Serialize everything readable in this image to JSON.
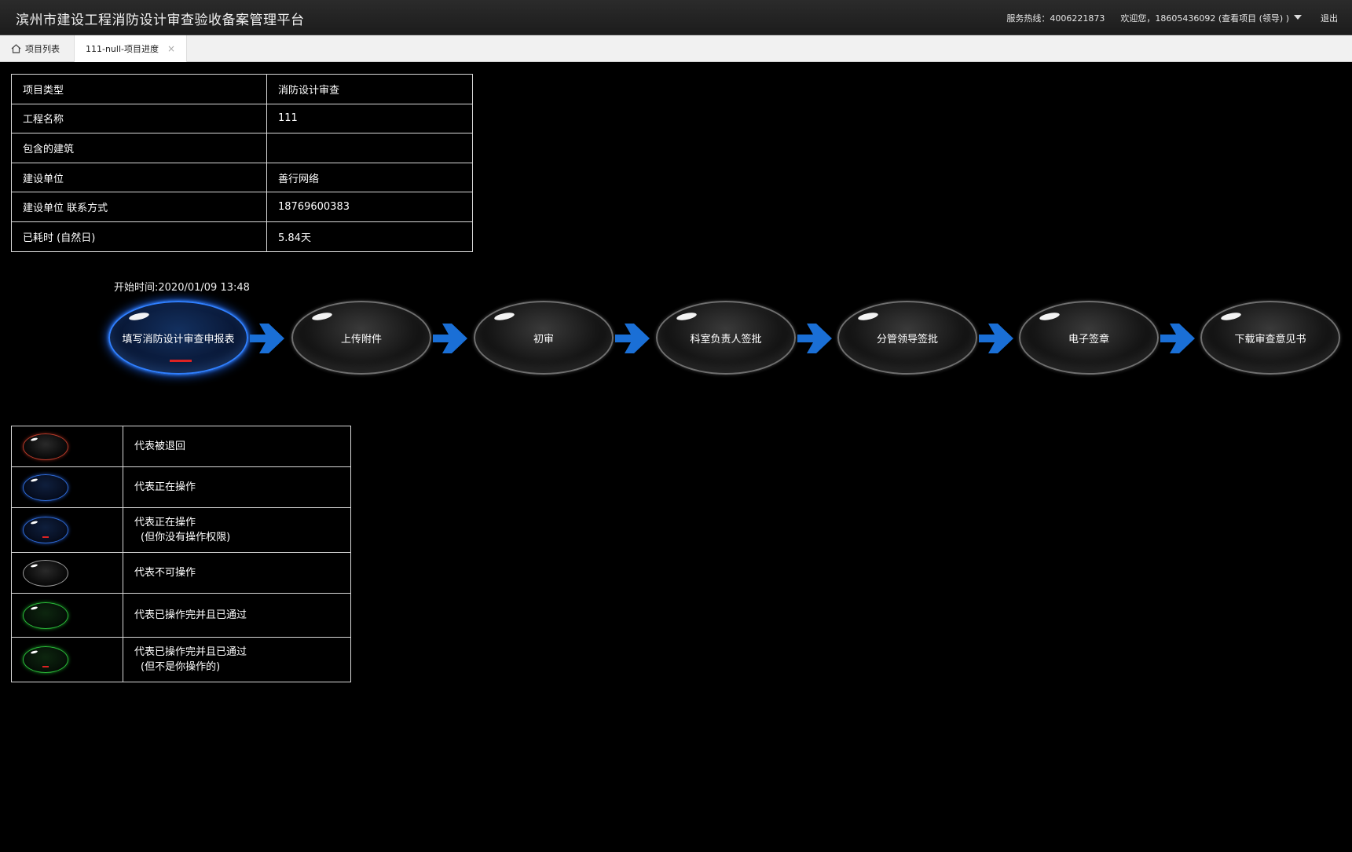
{
  "header": {
    "title": "滨州市建设工程消防设计审查验收备案管理平台",
    "hotline": "服务热线：4006221873",
    "welcome": "欢迎您，18605436092 (查看项目 (领导) )",
    "logout": "退出"
  },
  "tabs": {
    "home_label": "项目列表",
    "active_label": "111-null-项目进度",
    "close_glyph": "×"
  },
  "info": {
    "rows": [
      {
        "key": "项目类型",
        "value": "消防设计审查"
      },
      {
        "key": "工程名称",
        "value": "111"
      },
      {
        "key": "包含的建筑",
        "value": ""
      },
      {
        "key": "建设单位",
        "value": "善行网络"
      },
      {
        "key": "建设单位 联系方式",
        "value": "18769600383"
      },
      {
        "key": "已耗时 (自然日)",
        "value": "5.84天"
      }
    ]
  },
  "flow": {
    "start_time": "开始时间:2020/01/09 13:48",
    "steps": [
      {
        "label": "填写消防设计审查申报表",
        "state": "active-no-permission"
      },
      {
        "label": "上传附件",
        "state": "disabled"
      },
      {
        "label": "初审",
        "state": "disabled"
      },
      {
        "label": "科室负责人签批",
        "state": "disabled"
      },
      {
        "label": "分管领导签批",
        "state": "disabled"
      },
      {
        "label": "电子签章",
        "state": "disabled"
      },
      {
        "label": "下载审查意见书",
        "state": "disabled"
      }
    ],
    "arrow_color": "#1a6fd6"
  },
  "legend": {
    "rows": [
      {
        "label": "代表被退回",
        "note": "",
        "color": "red",
        "marker": false
      },
      {
        "label": "代表正在操作",
        "note": "",
        "color": "blue",
        "marker": false
      },
      {
        "label": "代表正在操作",
        "note": "(但你没有操作权限)",
        "color": "blue",
        "marker": true
      },
      {
        "label": "代表不可操作",
        "note": "",
        "color": "gray",
        "marker": false
      },
      {
        "label": "代表已操作完并且已通过",
        "note": "",
        "color": "green",
        "marker": false
      },
      {
        "label": "代表已操作完并且已通过",
        "note": "(但不是你操作的)",
        "color": "green",
        "marker": true
      }
    ]
  },
  "colors": {
    "background": "#000000",
    "active_node": "#2f7fff",
    "returned": "#b83a2a",
    "passed": "#2bbd3a",
    "marker": "#dd2222"
  }
}
